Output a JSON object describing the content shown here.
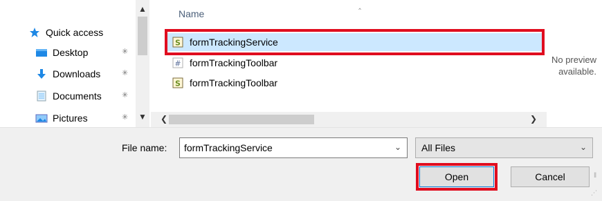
{
  "nav": {
    "items": [
      {
        "label": "Quick access",
        "icon": "star-icon",
        "pinned": false
      },
      {
        "label": "Desktop",
        "icon": "desktop-folder-icon",
        "pinned": true
      },
      {
        "label": "Downloads",
        "icon": "download-arrow-icon",
        "pinned": true
      },
      {
        "label": "Documents",
        "icon": "documents-icon",
        "pinned": true
      },
      {
        "label": "Pictures",
        "icon": "pictures-icon",
        "pinned": true
      }
    ]
  },
  "file_list": {
    "column_header": "Name",
    "files": [
      {
        "name": "formTrackingService",
        "icon": "script-file-icon",
        "selected": true
      },
      {
        "name": "formTrackingToolbar",
        "icon": "hash-file-icon",
        "selected": false
      },
      {
        "name": "formTrackingToolbar",
        "icon": "script-file-icon",
        "selected": false
      }
    ]
  },
  "preview": {
    "line1": "No preview",
    "line2": "available."
  },
  "bottom": {
    "file_name_label": "File name:",
    "file_name_value": "formTrackingService",
    "filter_value": "All Files",
    "open_label": "Open",
    "cancel_label": "Cancel"
  },
  "colors": {
    "selection": "#cce8ff",
    "highlight_box": "#e00d1f",
    "accent": "#0078d7"
  }
}
